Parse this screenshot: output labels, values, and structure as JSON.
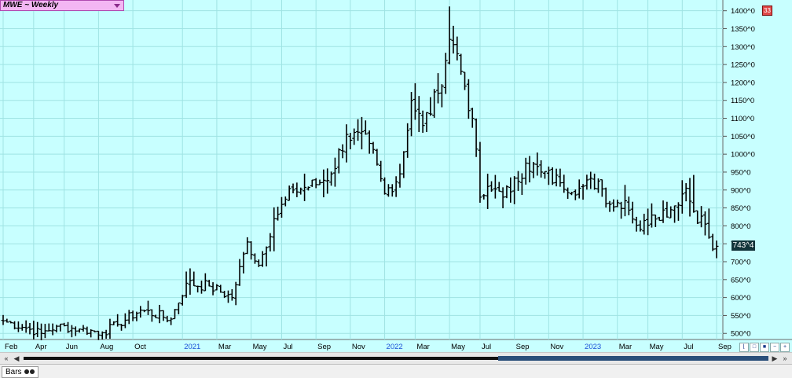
{
  "window": {
    "symbol_label": "MWE ~ Weekly",
    "corner_button": "33",
    "study_tab_label": "Bars",
    "last_price_label": "743^4"
  },
  "chart_data": {
    "type": "ohlc",
    "title": "MWE ~ Weekly",
    "y_ticks": [
      "500^0",
      "550^0",
      "600^0",
      "650^0",
      "700^0",
      "750^0",
      "800^0",
      "850^0",
      "900^0",
      "950^0",
      "1000^0",
      "1050^0",
      "1100^0",
      "1150^0",
      "1200^0",
      "1250^0",
      "1300^0",
      "1350^0",
      "1400^0"
    ],
    "y_tick_values": [
      500,
      550,
      600,
      650,
      700,
      750,
      800,
      850,
      900,
      950,
      1000,
      1050,
      1100,
      1150,
      1200,
      1250,
      1300,
      1350,
      1400
    ],
    "ylim": [
      483,
      1430
    ],
    "x_label_items": [
      {
        "label": "Feb",
        "week": 0,
        "year": false
      },
      {
        "label": "Apr",
        "week": 8,
        "year": false
      },
      {
        "label": "Jun",
        "week": 16,
        "year": false
      },
      {
        "label": "Aug",
        "week": 25,
        "year": false
      },
      {
        "label": "Oct",
        "week": 34,
        "year": false
      },
      {
        "label": "2021",
        "week": 47,
        "year": true
      },
      {
        "label": "Mar",
        "week": 56,
        "year": false
      },
      {
        "label": "May",
        "week": 65,
        "year": false
      },
      {
        "label": "Jul",
        "week": 73,
        "year": false
      },
      {
        "label": "Sep",
        "week": 82,
        "year": false
      },
      {
        "label": "Nov",
        "week": 91,
        "year": false
      },
      {
        "label": "2022",
        "week": 100,
        "year": true
      },
      {
        "label": "Mar",
        "week": 108,
        "year": false
      },
      {
        "label": "May",
        "week": 117,
        "year": false
      },
      {
        "label": "Jul",
        "week": 125,
        "year": false
      },
      {
        "label": "Sep",
        "week": 134,
        "year": false
      },
      {
        "label": "Nov",
        "week": 143,
        "year": false
      },
      {
        "label": "2023",
        "week": 152,
        "year": true
      },
      {
        "label": "Mar",
        "week": 161,
        "year": false
      },
      {
        "label": "May",
        "week": 169,
        "year": false
      },
      {
        "label": "Jul",
        "week": 178,
        "year": false
      },
      {
        "label": "Sep",
        "week": 187,
        "year": false
      }
    ],
    "key_points": [
      {
        "week": 0,
        "close": 535
      },
      {
        "week": 6,
        "close": 515
      },
      {
        "week": 10,
        "close": 500
      },
      {
        "week": 14,
        "close": 520
      },
      {
        "week": 20,
        "close": 512
      },
      {
        "week": 26,
        "close": 502
      },
      {
        "week": 30,
        "close": 525
      },
      {
        "week": 36,
        "close": 565
      },
      {
        "week": 44,
        "close": 540
      },
      {
        "week": 48,
        "close": 640
      },
      {
        "week": 54,
        "close": 632
      },
      {
        "week": 60,
        "close": 600
      },
      {
        "week": 64,
        "close": 755
      },
      {
        "week": 67,
        "close": 690
      },
      {
        "week": 71,
        "close": 820
      },
      {
        "week": 76,
        "close": 900
      },
      {
        "week": 82,
        "close": 915
      },
      {
        "week": 86,
        "close": 945
      },
      {
        "week": 90,
        "close": 1055
      },
      {
        "week": 96,
        "close": 1030
      },
      {
        "week": 100,
        "close": 890
      },
      {
        "week": 104,
        "close": 945
      },
      {
        "week": 107,
        "close": 1150
      },
      {
        "week": 110,
        "close": 1080
      },
      {
        "week": 114,
        "close": 1170
      },
      {
        "week": 117,
        "close": 1320
      },
      {
        "week": 119,
        "close": 1280
      },
      {
        "week": 121,
        "close": 1190
      },
      {
        "week": 123,
        "close": 1100
      },
      {
        "week": 125,
        "close": 880
      },
      {
        "week": 128,
        "close": 900
      },
      {
        "week": 133,
        "close": 895
      },
      {
        "week": 137,
        "close": 975
      },
      {
        "week": 141,
        "close": 950
      },
      {
        "week": 146,
        "close": 920
      },
      {
        "week": 151,
        "close": 905
      },
      {
        "week": 156,
        "close": 925
      },
      {
        "week": 159,
        "close": 860
      },
      {
        "week": 163,
        "close": 870
      },
      {
        "week": 167,
        "close": 790
      },
      {
        "week": 170,
        "close": 830
      },
      {
        "week": 175,
        "close": 845
      },
      {
        "week": 179,
        "close": 905
      },
      {
        "week": 181,
        "close": 840
      },
      {
        "week": 184,
        "close": 805
      },
      {
        "week": 186,
        "close": 735
      },
      {
        "week": 187,
        "close": 743
      }
    ],
    "last_value": 743.5,
    "grid": true,
    "background": "#c8ffff",
    "bar_color": "#000000",
    "grid_color": "#9fe3e3"
  }
}
